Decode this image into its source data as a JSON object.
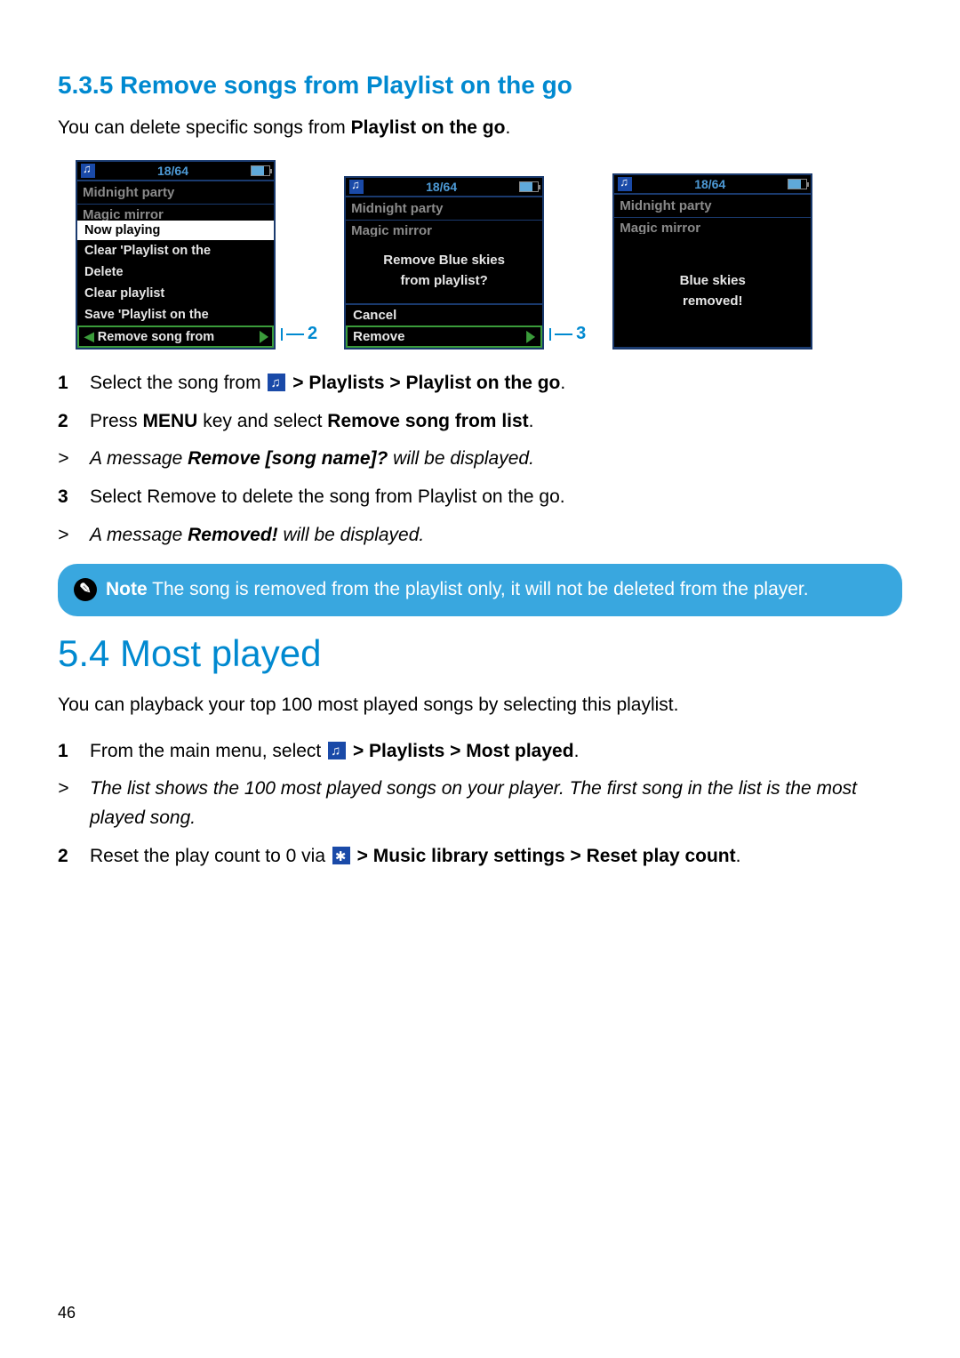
{
  "section535": {
    "heading": "5.3.5 Remove songs from Playlist on the go",
    "intro_pre": "You can delete specific songs from ",
    "intro_bold": "Playlist on the go",
    "intro_post": "."
  },
  "screens": {
    "header_count": "18/64",
    "row_midnight": "Midnight party",
    "row_magic": "Magic mirror",
    "s1": {
      "now_playing": "Now playing",
      "clear_ptg": "Clear 'Playlist on the",
      "delete": "Delete",
      "clear_playlist": "Clear playlist",
      "save_ptg": "Save 'Playlist on the",
      "remove_song": "Remove song from",
      "callout": "2"
    },
    "s2": {
      "line1": "Remove Blue skies",
      "line2": "from playlist?",
      "cancel": "Cancel",
      "remove": "Remove",
      "callout": "3"
    },
    "s3": {
      "line1": "Blue skies",
      "line2": "removed!"
    }
  },
  "steps535": {
    "s1_pre": "Select the song from ",
    "s1_b1": " > Playlists > Playlist on the go",
    "s1_post": ".",
    "s2_a": "Press ",
    "s2_b": "MENU",
    "s2_c": " key and select ",
    "s2_d": "Remove song from list",
    "s2_e": ".",
    "r1_a": "A message ",
    "r1_b": "Remove [song name]?",
    "r1_c": " will be displayed.",
    "s3": "Select Remove to delete the song from Playlist on the go.",
    "r2_a": "A message ",
    "r2_b": "Removed!",
    "r2_c": " will be displayed."
  },
  "note": {
    "label": "Note",
    "text": " The song is removed from the playlist only, it will not be deleted from the player."
  },
  "section54": {
    "heading": "5.4  Most played",
    "intro": "You can playback your top 100 most played songs by selecting this playlist.",
    "s1_a": "From the main menu, select ",
    "s1_b": " > Playlists > Most played",
    "s1_c": ".",
    "r1": "The list shows the 100 most played songs on your player. The first song in the list is the most played song.",
    "s2_a": "Reset the play count to 0 via ",
    "s2_b": " > Music library settings > Reset play count",
    "s2_c": "."
  },
  "page_number": "46"
}
